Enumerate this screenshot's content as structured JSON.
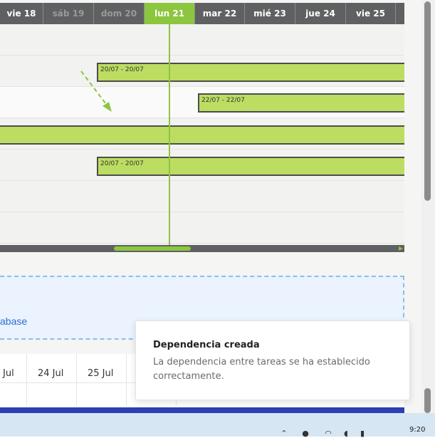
{
  "gantt": {
    "days": [
      {
        "label": "vie 18",
        "weekend": false,
        "today": false
      },
      {
        "label": "sáb 19",
        "weekend": true,
        "today": false
      },
      {
        "label": "dom 20",
        "weekend": true,
        "today": false
      },
      {
        "label": "lun 21",
        "weekend": false,
        "today": true
      },
      {
        "label": "mar 22",
        "weekend": false,
        "today": false
      },
      {
        "label": "mié 23",
        "weekend": false,
        "today": false
      },
      {
        "label": "jue 24",
        "weekend": false,
        "today": false
      },
      {
        "label": "vie 25",
        "weekend": false,
        "today": false
      }
    ],
    "bars": [
      {
        "label": "20/07 - 20/07"
      },
      {
        "label": "22/07 - 22/07"
      },
      {
        "label": ""
      },
      {
        "label": "20/07 - 20/07"
      }
    ],
    "bar_color": "#bcdd62",
    "today_color": "#8cc63f"
  },
  "drop_zone": {
    "link_text": "abase"
  },
  "calendar": {
    "dates": [
      "Jul",
      "24 Jul",
      "25 Jul"
    ]
  },
  "toast": {
    "title": "Dependencia creada",
    "message": "La dependencia entre tareas se ha establecido correctamente."
  },
  "taskbar": {
    "time": "9:20"
  }
}
